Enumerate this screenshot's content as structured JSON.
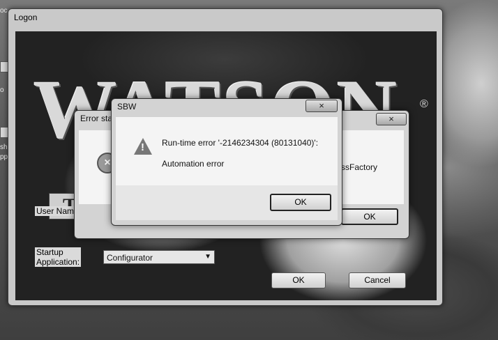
{
  "logon_window": {
    "title": "Logon",
    "logo_text": "WATSON",
    "logo_registered": "®",
    "logo_badge": "T",
    "user_name_label": "User Name",
    "startup_label_line1": "Startup",
    "startup_label_line2": "Application:",
    "startup_value": "Configurator",
    "ok_label": "OK",
    "cancel_label": "Cancel"
  },
  "error_dialog": {
    "title_partial": "Error sta",
    "message_partial": "ssFactory",
    "ok_label": "OK"
  },
  "sbw_dialog": {
    "title": "SBW",
    "message_line1": "Run-time error '-2146234304 (80131040)':",
    "message_line2": "Automation error",
    "ok_label": "OK"
  },
  "icons": {
    "close": "×",
    "error": "×",
    "warning": "!",
    "dropdown": "▼"
  },
  "desktop": {
    "icon_texts": [
      "oc",
      "o",
      "sh",
      "pp"
    ]
  }
}
